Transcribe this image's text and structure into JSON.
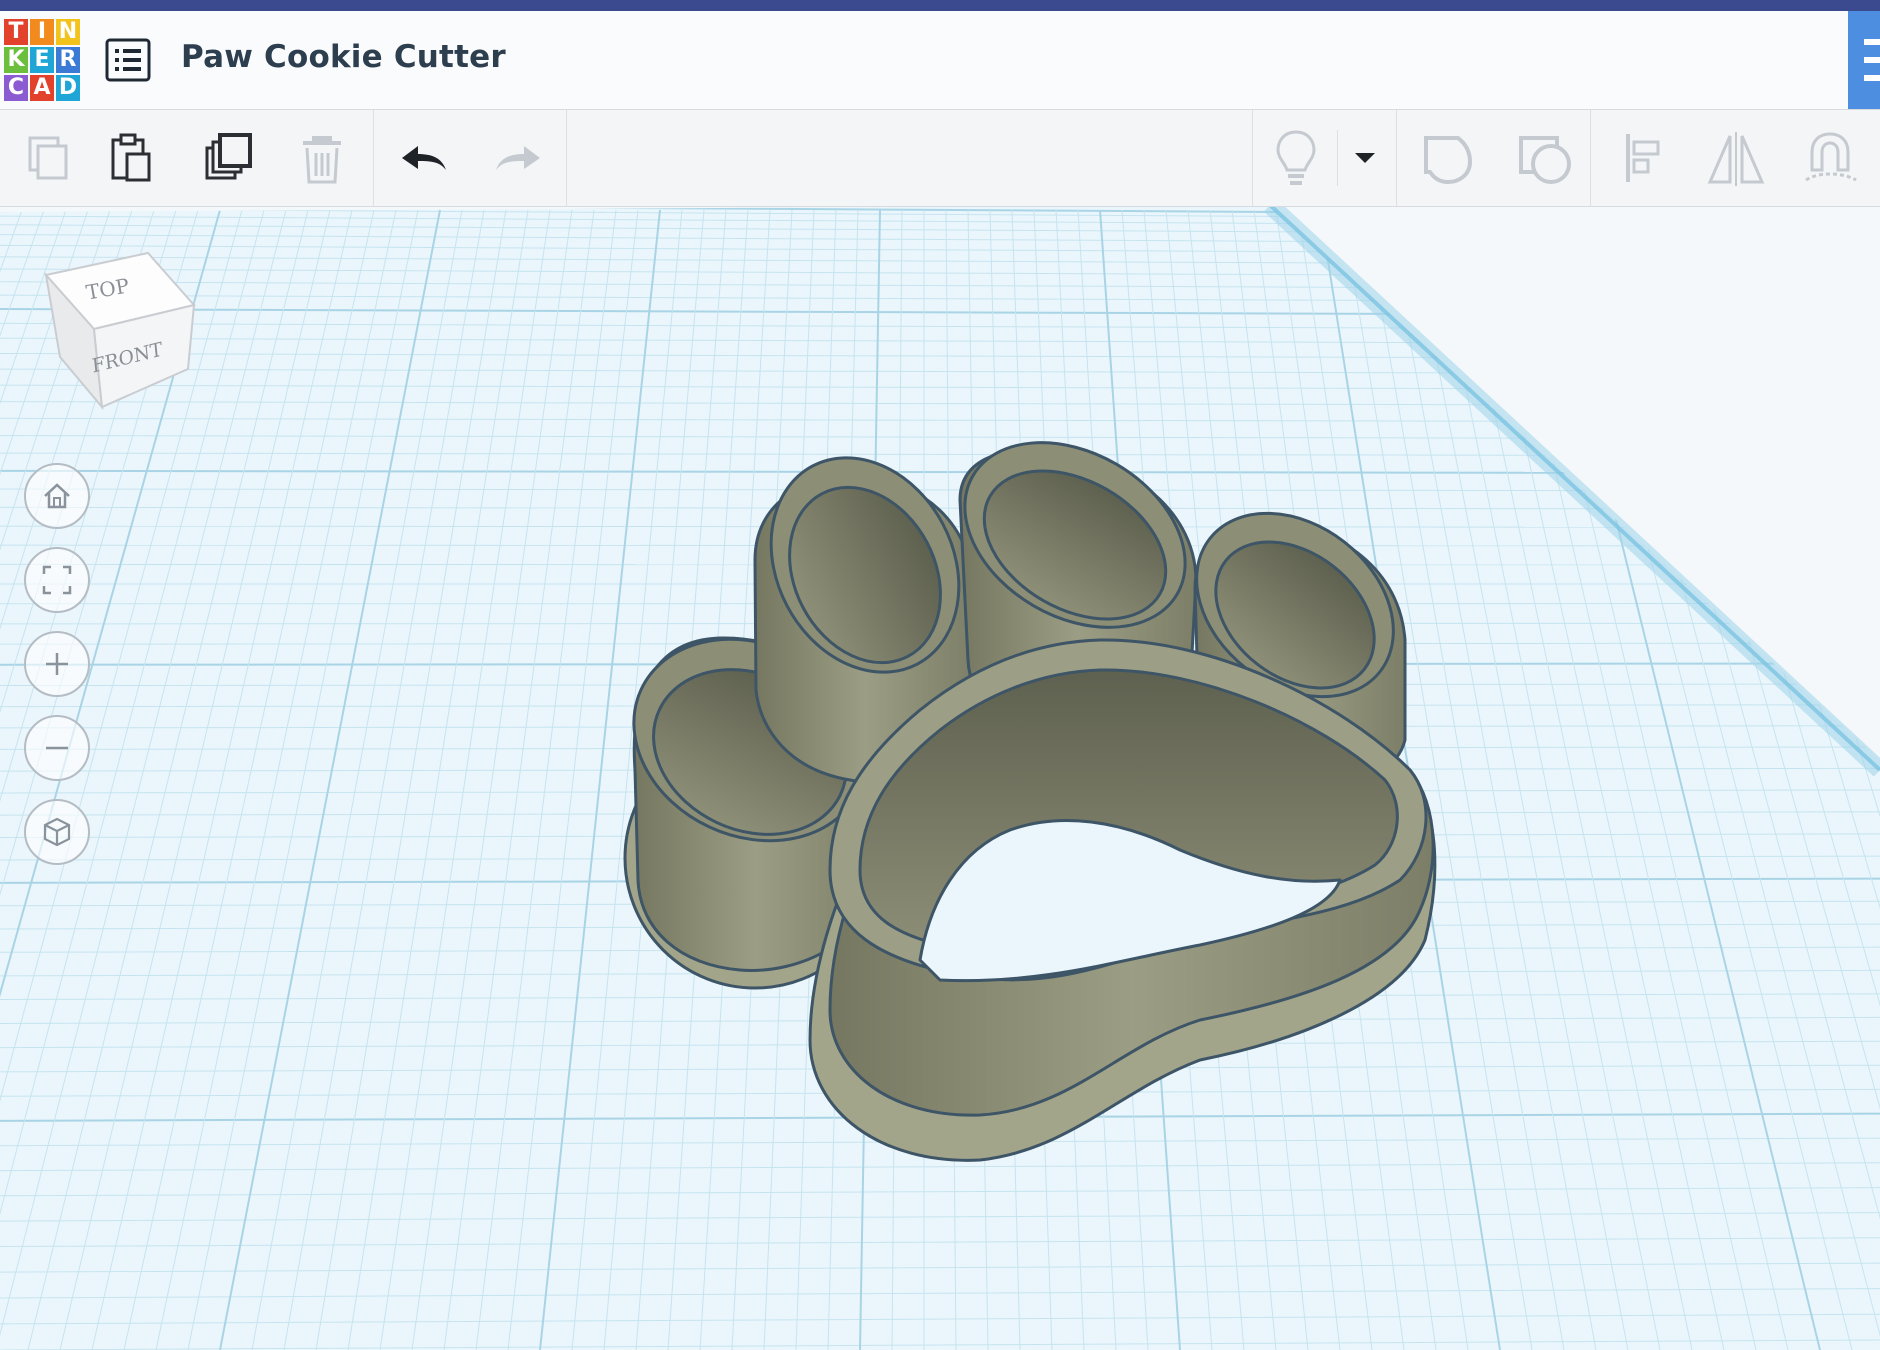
{
  "app": {
    "logo_letters": [
      "T",
      "I",
      "N",
      "K",
      "E",
      "R",
      "C",
      "A",
      "D"
    ],
    "logo_colors": [
      "#e2412b",
      "#f28a1d",
      "#f2c21d",
      "#6cbf3d",
      "#1fa6d6",
      "#3b7bd6",
      "#8a5bd1",
      "#e2412b",
      "#1fa6d6"
    ],
    "title": "Paw Cookie Cutter"
  },
  "header": {
    "menu_icon": "list-icon"
  },
  "toolbar": {
    "buttons": [
      {
        "name": "copy",
        "icon": "copy-icon",
        "enabled": false
      },
      {
        "name": "paste",
        "icon": "paste-icon",
        "enabled": true
      },
      {
        "name": "duplicate",
        "icon": "duplicate-icon",
        "enabled": true
      },
      {
        "name": "delete",
        "icon": "trash-icon",
        "enabled": false
      },
      {
        "name": "undo",
        "icon": "undo-icon",
        "enabled": true
      },
      {
        "name": "redo",
        "icon": "redo-icon",
        "enabled": false
      },
      {
        "name": "notes",
        "icon": "lightbulb-icon",
        "enabled": false
      },
      {
        "name": "notes-dropdown",
        "icon": "caret-down-icon",
        "enabled": true
      },
      {
        "name": "group",
        "icon": "group-icon",
        "enabled": false
      },
      {
        "name": "ungroup",
        "icon": "ungroup-icon",
        "enabled": false
      },
      {
        "name": "align",
        "icon": "align-icon",
        "enabled": false
      },
      {
        "name": "mirror",
        "icon": "mirror-icon",
        "enabled": false
      },
      {
        "name": "cruise",
        "icon": "magnet-icon",
        "enabled": false
      }
    ]
  },
  "viewcube": {
    "top_label": "TOP",
    "front_label": "FRONT"
  },
  "nav_controls": [
    "home-icon",
    "fit-view-icon",
    "zoom-in-icon",
    "zoom-out-icon",
    "perspective-icon"
  ],
  "colors": {
    "grid_bg": "#eef7fb",
    "grid_line": "#bfe0ee",
    "model_fill": "#8e9077",
    "model_outline": "#3d5566"
  }
}
